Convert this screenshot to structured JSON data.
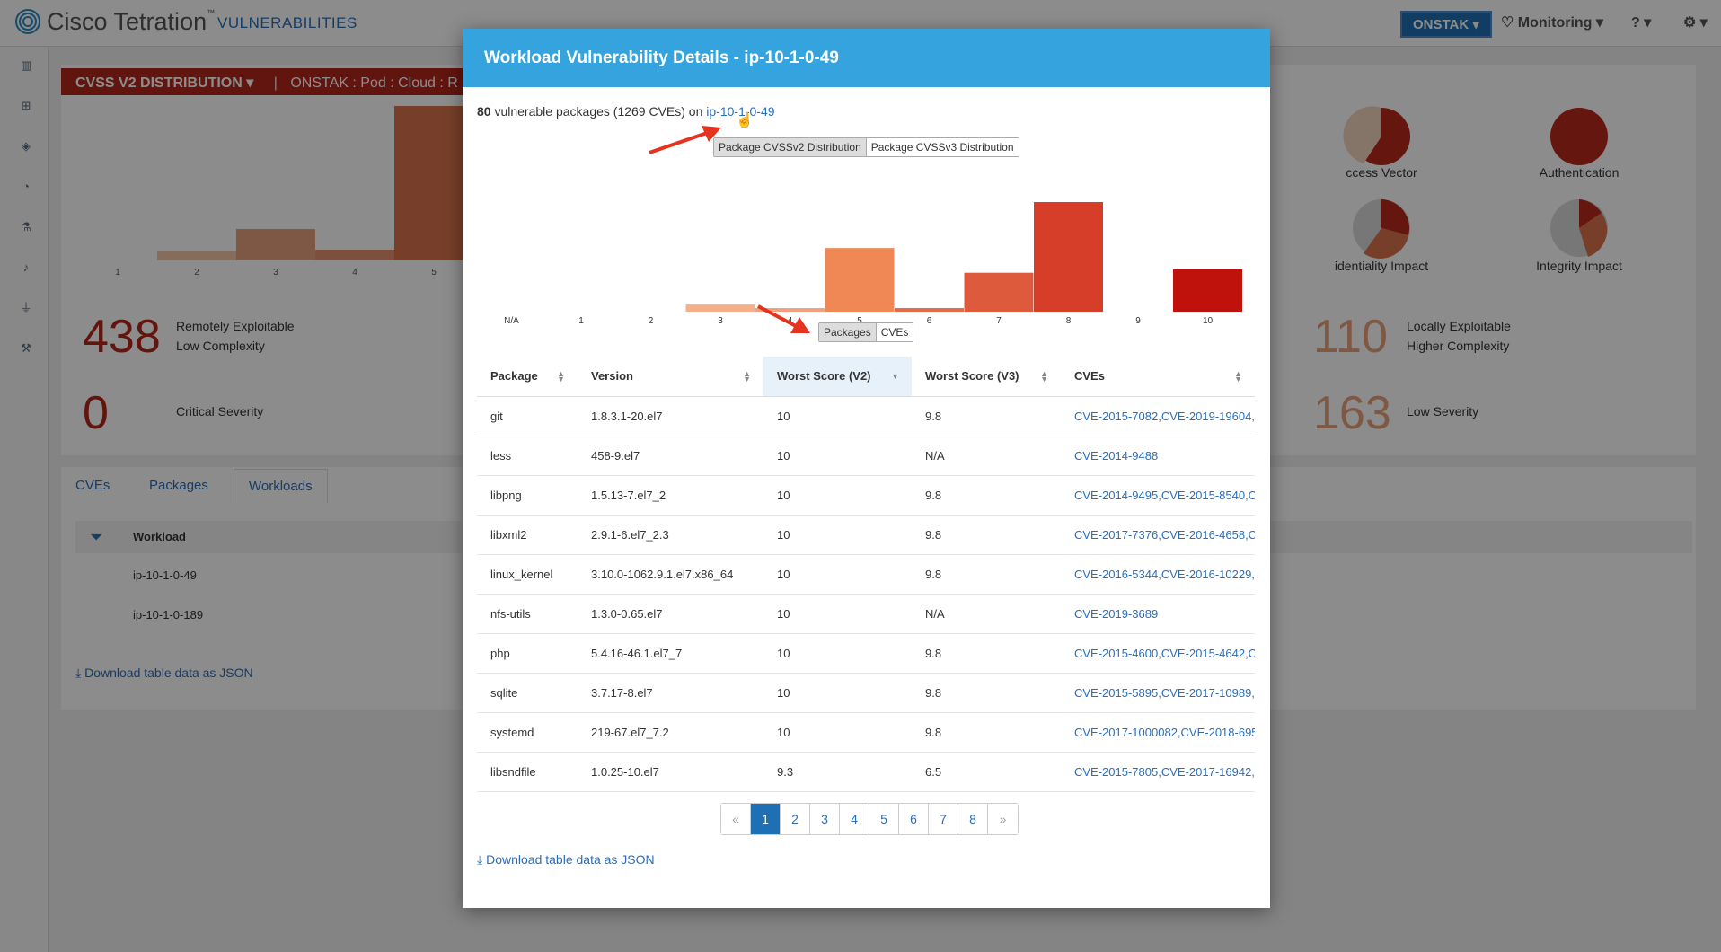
{
  "app": {
    "brand": "Cisco Tetrati",
    "brand_sup": "n",
    "section": "VULNERABILITIES",
    "tenant": "ONSTAK",
    "monitoring": "Monitoring"
  },
  "background": {
    "dist_header": "CVSS V2 DISTRIBUTION",
    "scope": "ONSTAK : Pod : Cloud : R",
    "bg_chart_ticks": [
      "1",
      "2",
      "3",
      "4",
      "5"
    ],
    "pies": [
      {
        "label": "ccess Vector"
      },
      {
        "label": "Authentication"
      },
      {
        "label": "identiality Impact"
      },
      {
        "label": "Integrity Impact"
      }
    ],
    "stats": [
      {
        "value": "438",
        "label1": "Remotely Exploitable",
        "label2": "Low Complexity",
        "color": "#b3251b"
      },
      {
        "value": "0",
        "label1": "Critical Severity",
        "label2": "",
        "color": "#b3251b"
      },
      {
        "value": "110",
        "label1": "Locally Exploitable",
        "label2": "Higher Complexity",
        "color": "#e8a07a"
      },
      {
        "value": "163",
        "label1": "Low Severity",
        "label2": "",
        "color": "#e8a07a"
      }
    ],
    "tabs": [
      "CVEs",
      "Packages",
      "Workloads"
    ],
    "workload_header": "Workload",
    "workloads": [
      "ip-10-1-0-49",
      "ip-10-1-0-189"
    ],
    "download": "Download table data as JSON"
  },
  "modal": {
    "title": "Workload Vulnerability Details - ip-10-1-0-49",
    "summary_count": "80",
    "summary_text": " vulnerable packages (1269 CVEs) on ",
    "summary_link": "ip-10-1-0-49",
    "dist_toggle": [
      "Package CVSSv2 Distribution",
      "Package CVSSv3 Distribution"
    ],
    "view_toggle": [
      "Packages",
      "CVEs"
    ],
    "columns": [
      "Package",
      "Version",
      "Worst Score (V2)",
      "Worst Score (V3)",
      "CVEs"
    ],
    "rows": [
      {
        "package": "git",
        "version": "1.8.3.1-20.el7",
        "v2": "10",
        "v3": "9.8",
        "cves": "CVE-2015-7082,CVE-2019-19604,"
      },
      {
        "package": "less",
        "version": "458-9.el7",
        "v2": "10",
        "v3": "N/A",
        "cves": "CVE-2014-9488"
      },
      {
        "package": "libpng",
        "version": "1.5.13-7.el7_2",
        "v2": "10",
        "v3": "9.8",
        "cves": "CVE-2014-9495,CVE-2015-8540,C"
      },
      {
        "package": "libxml2",
        "version": "2.9.1-6.el7_2.3",
        "v2": "10",
        "v3": "9.8",
        "cves": "CVE-2017-7376,CVE-2016-4658,C"
      },
      {
        "package": "linux_kernel",
        "version": "3.10.0-1062.9.1.el7.x86_64",
        "v2": "10",
        "v3": "9.8",
        "cves": "CVE-2016-5344,CVE-2016-10229,"
      },
      {
        "package": "nfs-utils",
        "version": "1.3.0-0.65.el7",
        "v2": "10",
        "v3": "N/A",
        "cves": "CVE-2019-3689"
      },
      {
        "package": "php",
        "version": "5.4.16-46.1.el7_7",
        "v2": "10",
        "v3": "9.8",
        "cves": "CVE-2015-4600,CVE-2015-4642,C"
      },
      {
        "package": "sqlite",
        "version": "3.7.17-8.el7",
        "v2": "10",
        "v3": "9.8",
        "cves": "CVE-2015-5895,CVE-2017-10989,"
      },
      {
        "package": "systemd",
        "version": "219-67.el7_7.2",
        "v2": "10",
        "v3": "9.8",
        "cves": "CVE-2017-1000082,CVE-2018-695"
      },
      {
        "package": "libsndfile",
        "version": "1.0.25-10.el7",
        "v2": "9.3",
        "v3": "6.5",
        "cves": "CVE-2015-7805,CVE-2017-16942,"
      }
    ],
    "pagination": [
      "«",
      "1",
      "2",
      "3",
      "4",
      "5",
      "6",
      "7",
      "8",
      "»"
    ],
    "active_page": "1",
    "download": "Download table data as JSON"
  },
  "chart_data": {
    "type": "bar",
    "categories": [
      "N/A",
      "1",
      "2",
      "3",
      "4",
      "5",
      "6",
      "7",
      "8",
      "9",
      "10"
    ],
    "values": [
      0,
      0,
      0,
      2,
      1,
      18,
      1,
      11,
      31,
      0,
      12
    ],
    "colors": [
      "#f7c8a8",
      "#f7c8a8",
      "#f7c8a8",
      "#f5b08a",
      "#f0a07a",
      "#f08856",
      "#e56a45",
      "#dd5a3c",
      "#d63e2a",
      "#c62a1e",
      "#c0120c"
    ]
  }
}
